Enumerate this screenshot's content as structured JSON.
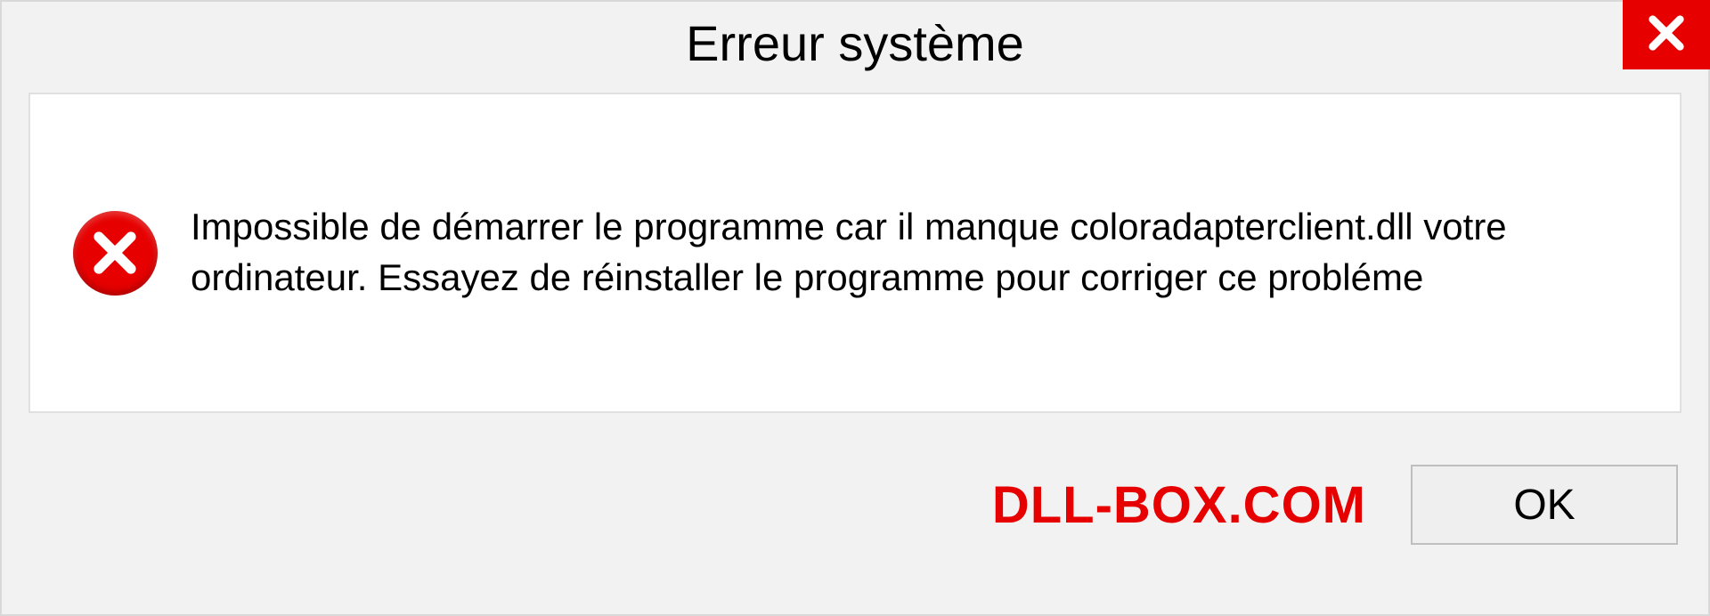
{
  "dialog": {
    "title": "Erreur système",
    "message": "Impossible de démarrer le programme car il manque coloradapterclient.dll votre ordinateur. Essayez de réinstaller le programme pour corriger ce probléme",
    "brand": "DLL-BOX.COM",
    "ok_label": "OK"
  }
}
